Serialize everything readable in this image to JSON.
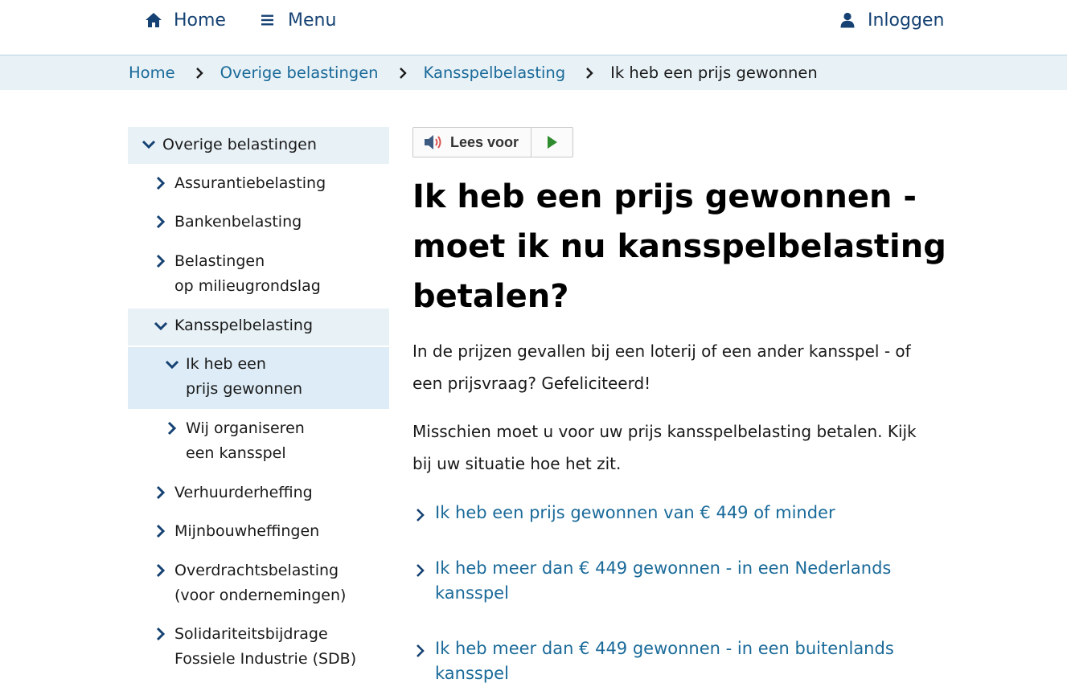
{
  "topnav": {
    "home_label": "Home",
    "menu_label": "Menu",
    "login_label": "Inloggen"
  },
  "breadcrumb": {
    "items": [
      "Home",
      "Overige belastingen",
      "Kansspelbelasting"
    ],
    "current": "Ik heb een prijs gewonnen"
  },
  "sidebar": {
    "section": "Overige belastingen",
    "items": [
      {
        "line1": "Assurantiebelasting",
        "line2": ""
      },
      {
        "line1": "Bankenbelasting",
        "line2": ""
      },
      {
        "line1": "Belastingen",
        "line2": "op milieugrondslag"
      },
      {
        "line1": "Kansspelbelasting",
        "line2": ""
      },
      {
        "line1": "Ik heb een",
        "line2": "prijs gewonnen"
      },
      {
        "line1": "Wij organiseren",
        "line2": "een kansspel"
      },
      {
        "line1": "Verhuurderheffing",
        "line2": ""
      },
      {
        "line1": "Mijnbouwheffingen",
        "line2": ""
      },
      {
        "line1": "Overdrachtsbelasting",
        "line2": "(voor ondernemingen)"
      },
      {
        "line1": "Solidariteitsbijdrage",
        "line2": "Fossiele Industrie (SDB)"
      }
    ]
  },
  "readspeaker": {
    "label": "Lees voor"
  },
  "main": {
    "title_lines": [
      "Ik heb een prijs gewonnen -",
      "moet ik nu kansspelbelasting",
      "betalen?"
    ],
    "para1_lines": [
      "In de prijzen gevallen bij een loterij of een ander kansspel - of",
      "een prijsvraag? Gefeliciteerd!"
    ],
    "para2_lines": [
      "Misschien moet u voor uw prijs kansspelbelasting betalen. Kijk",
      "bij uw situatie hoe het zit."
    ],
    "links": [
      {
        "line1": "Ik heb een prijs gewonnen van € 449 of minder",
        "line2": ""
      },
      {
        "line1": "Ik heb meer dan € 449 gewonnen - in een Nederlands",
        "line2": "kansspel"
      },
      {
        "line1": "Ik heb meer dan € 449 gewonnen - in een buitenlands",
        "line2": "kansspel"
      }
    ]
  },
  "colors": {
    "brand_dark": "#154273",
    "link": "#1a6a99",
    "highlight_bg": "#e8f1f6",
    "active_bg": "#ddecf6",
    "play_green": "#2e8b2e"
  }
}
